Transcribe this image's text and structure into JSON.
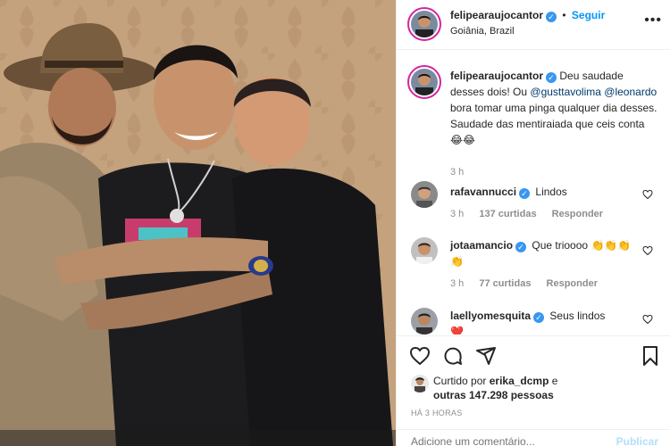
{
  "header": {
    "username": "felipearaujocantor",
    "verified_mark": "✓",
    "separator": "•",
    "follow_label": "Seguir",
    "location": "Goiânia, Brazil",
    "more_glyph": "•••"
  },
  "caption": {
    "username": "felipearaujocantor",
    "text_1": "Deu saudade desses dois! Ou",
    "mention_1": "@gusttavolima",
    "mention_2": "@leonardo",
    "text_2": "bora tomar uma pinga qualquer dia desses. Saudade das mentiraiada que ceis conta",
    "emoji": "😂😂",
    "time": "3 h"
  },
  "comments": [
    {
      "username": "rafavannucci",
      "text": "Lindos",
      "time": "3 h",
      "likes": "137 curtidas",
      "reply": "Responder"
    },
    {
      "username": "jotaamancio",
      "text": "Que trioooo",
      "emoji": "👏👏👏👏",
      "time": "3 h",
      "likes": "77 curtidas",
      "reply": "Responder"
    },
    {
      "username": "laellyomesquita",
      "text": "Seus lindos",
      "emoji": "❤️"
    }
  ],
  "likes": {
    "prefix": "Curtido por",
    "user": "erika_dcmp",
    "connector": "e",
    "others": "outras 147.298 pessoas"
  },
  "timestamp": "HÁ 3 HORAS",
  "add_comment": {
    "placeholder": "Adicione um comentário...",
    "publish": "Publicar"
  },
  "colors": {
    "accent": "#0095f6",
    "verified": "#3897f0",
    "heart_red": "#ed4956"
  }
}
